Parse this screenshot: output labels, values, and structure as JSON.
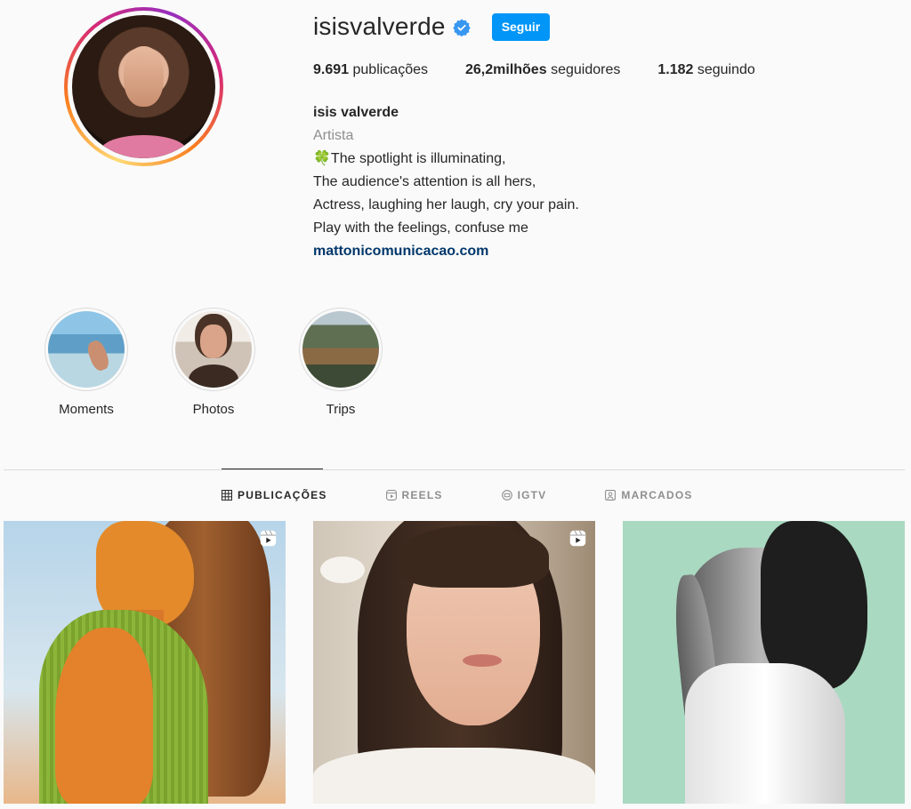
{
  "profile": {
    "username": "isisvalverde",
    "follow_label": "Seguir",
    "stats": {
      "posts_count": "9.691",
      "posts_label": "publicações",
      "followers_count": "26,2milhões",
      "followers_label": "seguidores",
      "following_count": "1.182",
      "following_label": "seguindo"
    },
    "full_name": "isis valverde",
    "category": "Artista",
    "bio_lines": [
      "🍀The spotlight is illuminating,",
      "The audience's attention is all hers,",
      "Actress, laughing her laugh, cry your pain.",
      "Play with the feelings, confuse me"
    ],
    "website": "mattonicomunicacao.com"
  },
  "highlights": [
    {
      "label": "Moments",
      "icon": "sea-photo"
    },
    {
      "label": "Photos",
      "icon": "portrait-photo"
    },
    {
      "label": "Trips",
      "icon": "landscape-photo"
    }
  ],
  "tabs": [
    {
      "label": "PUBLICAÇÕES",
      "icon": "grid-icon",
      "active": true
    },
    {
      "label": "REELS",
      "icon": "reels-icon",
      "active": false
    },
    {
      "label": "IGTV",
      "icon": "igtv-icon",
      "active": false
    },
    {
      "label": "MARCADOS",
      "icon": "tagged-icon",
      "active": false
    }
  ],
  "posts": [
    {
      "type": "reel"
    },
    {
      "type": "reel"
    },
    {
      "type": "photo"
    }
  ],
  "colors": {
    "accent": "#0095f6",
    "link": "#00376b",
    "muted": "#8e8e8e",
    "background": "#fafafa"
  }
}
